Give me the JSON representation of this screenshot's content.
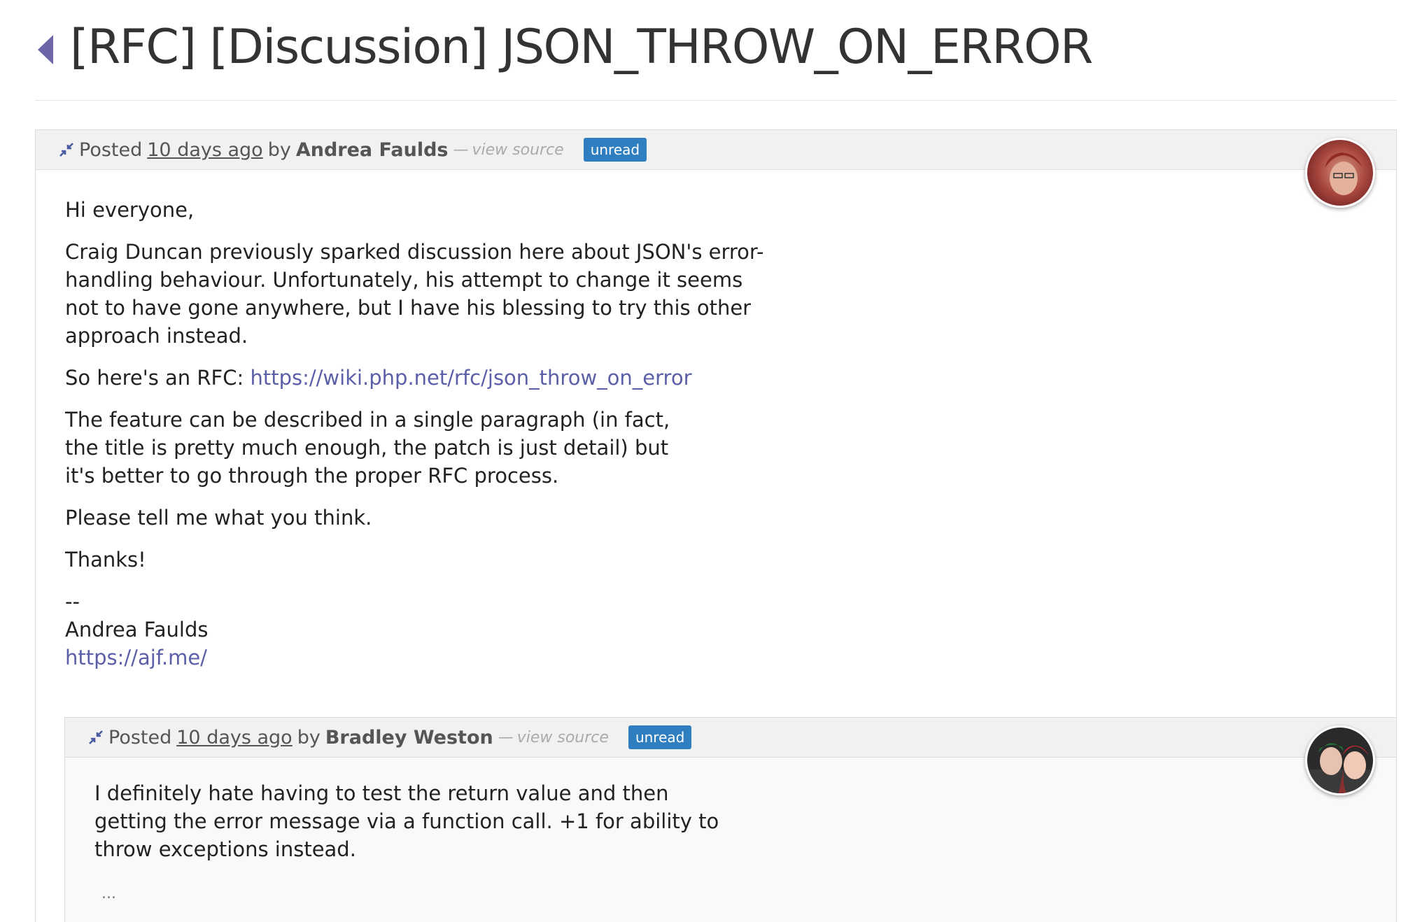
{
  "thread": {
    "title": "[RFC] [Discussion] JSON_THROW_ON_ERROR"
  },
  "colors": {
    "link": "#5a5fa8",
    "badge": "#2f7fc0",
    "back_arrow": "#6c66a8"
  },
  "posts": [
    {
      "posted_label": "Posted",
      "time": "10 days ago",
      "by_label": "by",
      "author": "Andrea Faulds",
      "view_source": "view source",
      "badge": "unread",
      "body": {
        "greeting": "Hi everyone,",
        "para1": "Craig Duncan previously sparked discussion here about JSON's error-handling behaviour. Unfortunately, his attempt to change it seems not to have gone anywhere, but I have his blessing to try this other approach instead.",
        "rfc_prefix": "So here's an RFC:",
        "rfc_link": "https://wiki.php.net/rfc/json_throw_on_error",
        "para3": "The feature can be described in a single paragraph (in fact, the title is pretty much enough, the patch is just detail) but it's better to go through the proper RFC process.",
        "para4": "Please tell me what you think.",
        "thanks": "Thanks!",
        "sig_sep": "--",
        "sig_name": "Andrea Faulds",
        "sig_link": "https://ajf.me/"
      },
      "collapse_icon": "collapse-arrows-icon"
    },
    {
      "posted_label": "Posted",
      "time": "10 days ago",
      "by_label": "by",
      "author": "Bradley Weston",
      "view_source": "view source",
      "badge": "unread",
      "body": {
        "para1": "I definitely hate having to test the return value and then getting the error message via a function call. +1 for ability to throw exceptions instead.",
        "more": "..."
      },
      "collapse_icon": "collapse-arrows-icon"
    }
  ]
}
